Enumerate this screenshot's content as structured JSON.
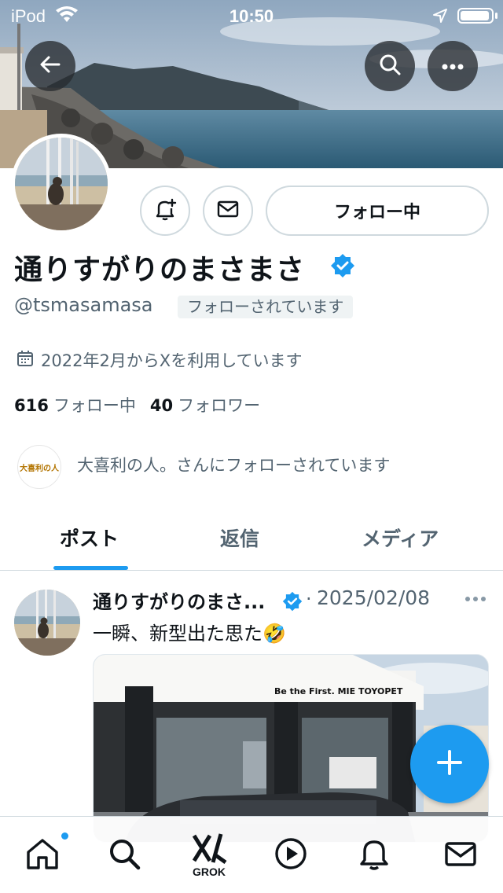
{
  "status_bar": {
    "carrier": "iPod",
    "time": "10:50"
  },
  "profile": {
    "name": "通りすがりのまさまさ",
    "handle": "@tsmasamasa",
    "follows_you_badge": "フォローされています",
    "joined": "2022年2月からXを利用しています",
    "following_count": "616",
    "following_label": "フォロー中",
    "followers_count": "40",
    "followers_label": "フォロワー",
    "follow_button_label": "フォロー中",
    "mutual_avatar_text": "大喜利の人",
    "mutual_text": "大喜利の人。さんにフォローされています"
  },
  "tabs": [
    {
      "label": "ポスト",
      "active": true
    },
    {
      "label": "返信",
      "active": false
    },
    {
      "label": "メディア",
      "active": false
    }
  ],
  "post": {
    "author": "通りすがりのまさ...",
    "date": "2025/02/08",
    "separator": "·",
    "text": "一瞬、新型出た思た🤣",
    "image_sign_text": "Be the First.  MIE TOYOPET"
  },
  "bottom_nav": {
    "grok_label": "GROK"
  },
  "colors": {
    "accent": "#1d9bf0",
    "text_primary": "#0f1419",
    "text_secondary": "#536471"
  },
  "icons": [
    "back-arrow-icon",
    "search-icon",
    "more-icon",
    "bell-plus-icon",
    "mail-icon",
    "verified-badge-icon",
    "calendar-icon",
    "compose-plus-icon",
    "home-icon",
    "grok-icon",
    "play-icon",
    "bell-icon"
  ]
}
